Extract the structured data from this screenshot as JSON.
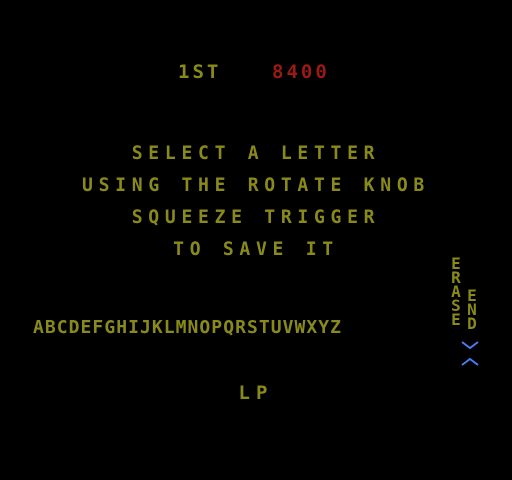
{
  "colors": {
    "background": "#000000",
    "text": "#8a8a1c",
    "score": "#9a1a14",
    "selector": "#4a7cf0"
  },
  "header": {
    "rank": "1ST",
    "score": "8400"
  },
  "instructions": {
    "line1": "SELECT A LETTER",
    "line2": "USING THE ROTATE KNOB",
    "line3": "SQUEEZE TRIGGER",
    "line4": "TO SAVE IT"
  },
  "letter_picker": {
    "alphabet": "ABCDEFGHIJKLMNOPQRSTUVWXYZ",
    "erase_label": [
      "E",
      "R",
      "A",
      "S",
      "E"
    ],
    "end_label": [
      "E",
      "N",
      "D"
    ],
    "selector_icon_down": "chevron-down-icon",
    "selector_icon_up": "chevron-up-icon"
  },
  "entry": {
    "initials": "LP"
  }
}
